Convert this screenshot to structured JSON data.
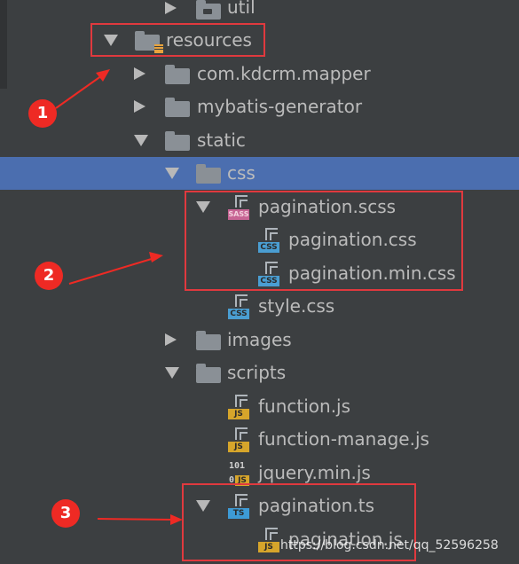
{
  "tree": {
    "util": "util",
    "resources": "resources",
    "mapper": "com.kdcrm.mapper",
    "generator": "mybatis-generator",
    "static": "static",
    "css": "css",
    "scss": "pagination.scss",
    "pagination_css": "pagination.css",
    "pagination_min_css": "pagination.min.css",
    "style_css": "style.css",
    "images": "images",
    "scripts": "scripts",
    "function_js": "function.js",
    "function_manage_js": "function-manage.js",
    "jquery_min_js": "jquery.min.js",
    "pagination_ts": "pagination.ts",
    "pagination_js": "pagination.js"
  },
  "file_tags": {
    "sass": "SASS",
    "css": "CSS",
    "js": "JS",
    "ts": "TS",
    "min_top": "101",
    "min_bottom": "0"
  },
  "annotations": {
    "one": "1",
    "two": "2",
    "three": "3"
  },
  "watermark": "https://blog.csdn.net/qq_52596258",
  "colors": {
    "background": "#3c3f41",
    "selection": "#4b6eaf",
    "highlight_box": "#e0393e",
    "badge": "#ee2a24",
    "css_tag": "#4a9ed2",
    "sass_tag": "#c76494",
    "js_tag": "#d6a52b",
    "ts_tag": "#3d9bd6"
  }
}
